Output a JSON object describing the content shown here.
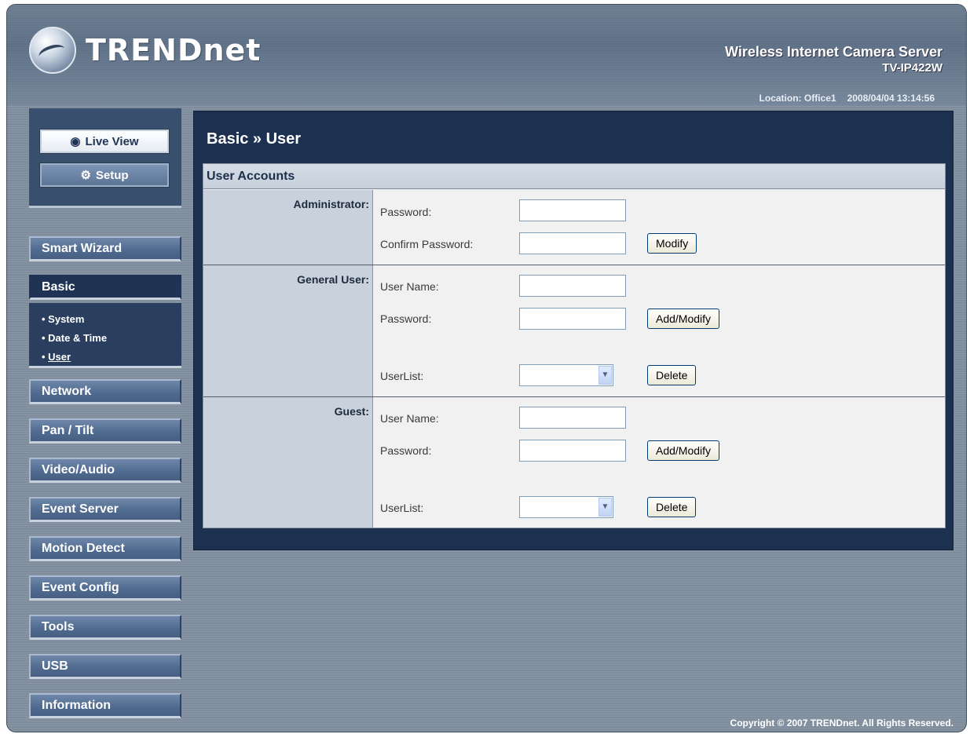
{
  "brand": {
    "logo_text": "TRENDnet",
    "product_name": "Wireless Internet Camera Server",
    "model": "TV-IP422W"
  },
  "status": {
    "location": "Location: Office1",
    "datetime": "2008/04/04 13:14:56"
  },
  "top_buttons": {
    "live_view": "Live View",
    "setup": "Setup"
  },
  "nav": {
    "smart_wizard": "Smart Wizard",
    "basic": "Basic",
    "basic_sub": [
      "System",
      "Date & Time",
      "User"
    ],
    "network": "Network",
    "pan_tilt": "Pan / Tilt",
    "video_audio": "Video/Audio",
    "event_server": "Event Server",
    "motion_detect": "Motion Detect",
    "event_config": "Event Config",
    "tools": "Tools",
    "usb": "USB",
    "information": "Information"
  },
  "page": {
    "title": "Basic » User",
    "panel_title": "User Accounts"
  },
  "administrator": {
    "label": "Administrator:",
    "password_label": "Password:",
    "confirm_label": "Confirm Password:",
    "password_value": "",
    "confirm_value": "",
    "modify_button": "Modify"
  },
  "general_user": {
    "label": "General User:",
    "username_label": "User Name:",
    "password_label": "Password:",
    "userlist_label": "UserList:",
    "username_value": "",
    "password_value": "",
    "userlist_selected": "",
    "add_button": "Add/Modify",
    "delete_button": "Delete"
  },
  "guest": {
    "label": "Guest:",
    "username_label": "User Name:",
    "password_label": "Password:",
    "userlist_label": "UserList:",
    "username_value": "",
    "password_value": "",
    "userlist_selected": "",
    "add_button": "Add/Modify",
    "delete_button": "Delete"
  },
  "footer": {
    "copyright": "Copyright © 2007 TRENDnet. All Rights Reserved."
  }
}
